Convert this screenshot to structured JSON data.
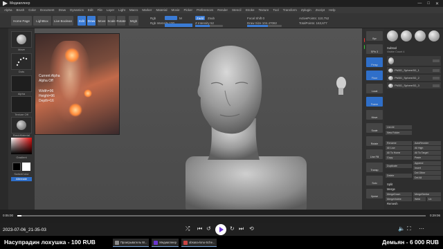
{
  "player": {
    "title": "Медиаплеер",
    "controls": {
      "minimize": "—",
      "maximize": "□",
      "close": "✕"
    }
  },
  "zbrush_menu": [
    "Alpha",
    "Brush",
    "Color",
    "Document",
    "Draw",
    "Dynamics",
    "Edit",
    "File",
    "Layer",
    "Light",
    "Macro",
    "Marker",
    "Material",
    "Movie",
    "Picker",
    "Preferences",
    "Render",
    "Stencil",
    "Stroke",
    "Texture",
    "Tool",
    "Transform",
    "Zplugin",
    "Zscript",
    "Help"
  ],
  "toolbar": {
    "home_page": "Home Page",
    "lightbox": "LightBox",
    "live_boolean": "Live Boolean",
    "edit": "Edit",
    "draw": "Draw",
    "move": "Move",
    "scale": "Scale",
    "rotate": "Rotate",
    "mrgb": "Mrgb",
    "rgb": "Rgb",
    "m": "M",
    "zadd": "Zadd",
    "zsub": "Zsub",
    "rgb_intensity": "Rgb Intensity 100",
    "z_intensity": "Z Intensity 52",
    "focal_shift": "Focal Shift 0",
    "draw_size": "Draw Size 104.47082",
    "active_points": "ActivePoints: 110,752",
    "total_points": "TotalPoints: 163,677",
    "rgb_intensity_level": 1.0,
    "z_intensity_level": 0.52,
    "draw_size_level": 0.6
  },
  "left_shelf": {
    "brush_label": "Move",
    "stroke_label": "Dots",
    "alpha_label": "Alpha",
    "texture_label": "Texture Off",
    "material_label": "BasicMaterial",
    "gradient_label": "Gradient",
    "switch_label": "SwitchColor",
    "alternate_label": "Alternate"
  },
  "alpha_popup": {
    "title": "Current Alpha",
    "state": "Alpha Off",
    "width": "Width=96",
    "height": "Height=96",
    "depth": "Depth=16"
  },
  "right_column": [
    "Bpr",
    "SPix 3",
    "Persp",
    "Floor",
    "Local",
    "Frame",
    "Move",
    "Scale",
    "Rotate",
    "Line Fill",
    "Transp",
    "Solo",
    "Xpose"
  ],
  "subtool": {
    "title": "Subtool",
    "visible_count": "Visible Count 4",
    "items": [
      "PM3D_Sphere3D_1",
      "PM3D_Sphere3D_2",
      "PM3D_Sphere3D_3"
    ],
    "list_all": "List All",
    "new_folder": "New Folder",
    "rename": "Rename",
    "autoreorder": "AutoReorder",
    "all_low": "All Low",
    "all_high": "All High",
    "all_to_home": "All To Home",
    "all_to_target": "All To Target",
    "copy": "Copy",
    "paste": "Paste",
    "append": "Append",
    "duplicate": "Duplicate",
    "insert": "Insert",
    "delete": "Delete",
    "del_other": "Del Other",
    "del_all": "Del All",
    "split": "Split",
    "merge": "Merge",
    "merge_down": "MergeDown",
    "merge_similar": "MergeSimilar",
    "merge_visible": "MergeVisible",
    "weld": "Weld",
    "uv": "Uv",
    "remesh": "Remesh",
    "project": "Project",
    "extract": "Extract"
  },
  "seek": {
    "current": "0:05:00",
    "total": "0:29:06",
    "progress": 0.01
  },
  "timestamp": "2023-07-06_21-35-03",
  "donations": {
    "left": "Насупрадин лохушка - 100 RUB",
    "right": "Демьян - 6 000 RUB"
  },
  "taskbar": [
    "Проигрыватель W...",
    "Медиаплеер",
    "obsana-lonu-Sche..."
  ],
  "colors": {
    "accent": "#3a7bd5",
    "play_icon": "#6a35d0"
  }
}
